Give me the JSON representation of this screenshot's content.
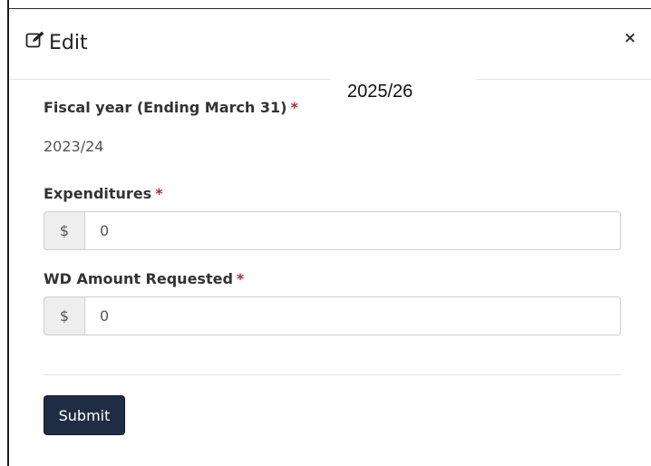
{
  "modal": {
    "title": "Edit",
    "close_label": "×"
  },
  "overlay_year": "2025/26",
  "fiscal_year": {
    "label": "Fiscal year (Ending March 31)",
    "required_marker": "*",
    "value": "2023/24"
  },
  "expenditures": {
    "label": "Expenditures",
    "required_marker": "*",
    "currency": "$",
    "value": "0"
  },
  "wd_amount": {
    "label": "WD Amount Requested",
    "required_marker": "*",
    "currency": "$",
    "value": "0"
  },
  "submit_label": "Submit",
  "colors": {
    "button": "#1f2d44",
    "required": "#a33333"
  }
}
